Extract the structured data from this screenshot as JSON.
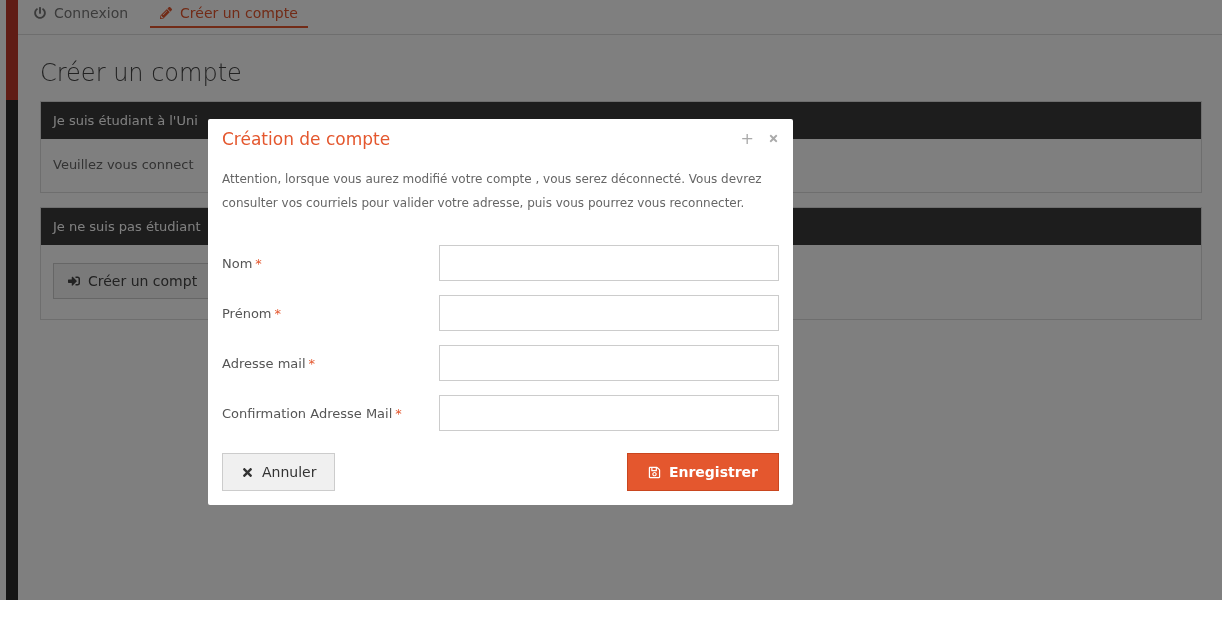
{
  "tabs": [
    {
      "label": "Connexion",
      "kind": "login",
      "selected": false
    },
    {
      "label": "Créer un compte",
      "kind": "signup",
      "selected": true
    }
  ],
  "page_title": "Créer un compte",
  "panels": [
    {
      "header": "Je suis étudiant à l'Uni",
      "body_text": "Veuillez vous connect"
    },
    {
      "header": "Je ne suis pas étudiant",
      "button": "Créer un compt"
    }
  ],
  "modal": {
    "title": "Création de compte",
    "expand_glyph": "+",
    "message": "Attention, lorsque vous aurez modifié votre compte , vous serez déconnecté. Vous devrez consulter vos courriels pour valider votre adresse, puis vous pourrez vous reconnecter.",
    "fields": [
      {
        "label": "Nom",
        "required_mark": "*"
      },
      {
        "label": "Prénom",
        "required_mark": "*"
      },
      {
        "label": "Adresse mail",
        "required_mark": "*"
      },
      {
        "label": "Confirmation Adresse Mail",
        "required_mark": "*"
      }
    ],
    "cancel_button": "Annuler",
    "save_button": "Enregistrer"
  }
}
